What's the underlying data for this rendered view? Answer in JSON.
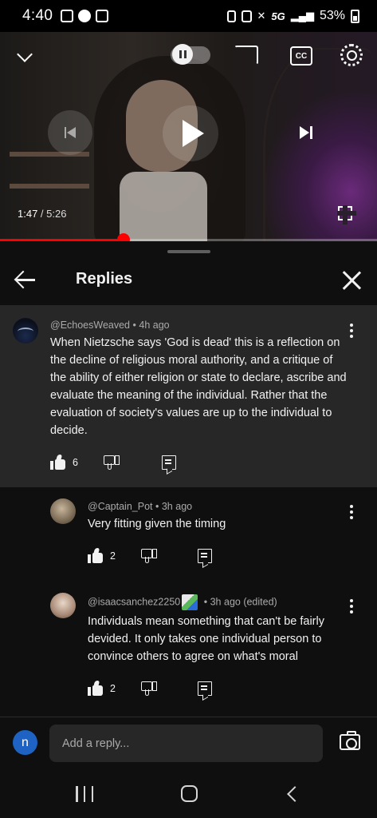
{
  "status_bar": {
    "time": "4:40",
    "network": "5G",
    "battery": "53%"
  },
  "player": {
    "current_time": "1:47",
    "separator": " / ",
    "duration": "5:26",
    "progress_fraction": 0.328,
    "cc_label": "CC",
    "accent_color": "#ff0000"
  },
  "replies_panel": {
    "title": "Replies",
    "parent": {
      "author": "@EchoesWeaved",
      "age": "4h ago",
      "text": "When Nietzsche says 'God is dead' this is a reflection on the decline of religious moral authority, and a critique of the ability of either religion or state to declare, ascribe and evaluate the meaning of the individual. Rather that the evaluation of society's values are up to the individual to decide.",
      "likes": "6"
    },
    "replies": [
      {
        "author": "@Captain_Pot",
        "age": "3h ago",
        "text": "Very fitting given the timing",
        "likes": "2"
      },
      {
        "author": "@isaacsanchez2250",
        "age": "3h ago (edited)",
        "text": "Individuals mean something that can't be fairly devided. It only takes one individual person to convince others to agree on what's moral",
        "likes": "2"
      }
    ],
    "separator_dot": "•"
  },
  "reply_input": {
    "placeholder": "Add a reply...",
    "user_initial": "n",
    "avatar_color": "#1e63c4"
  }
}
